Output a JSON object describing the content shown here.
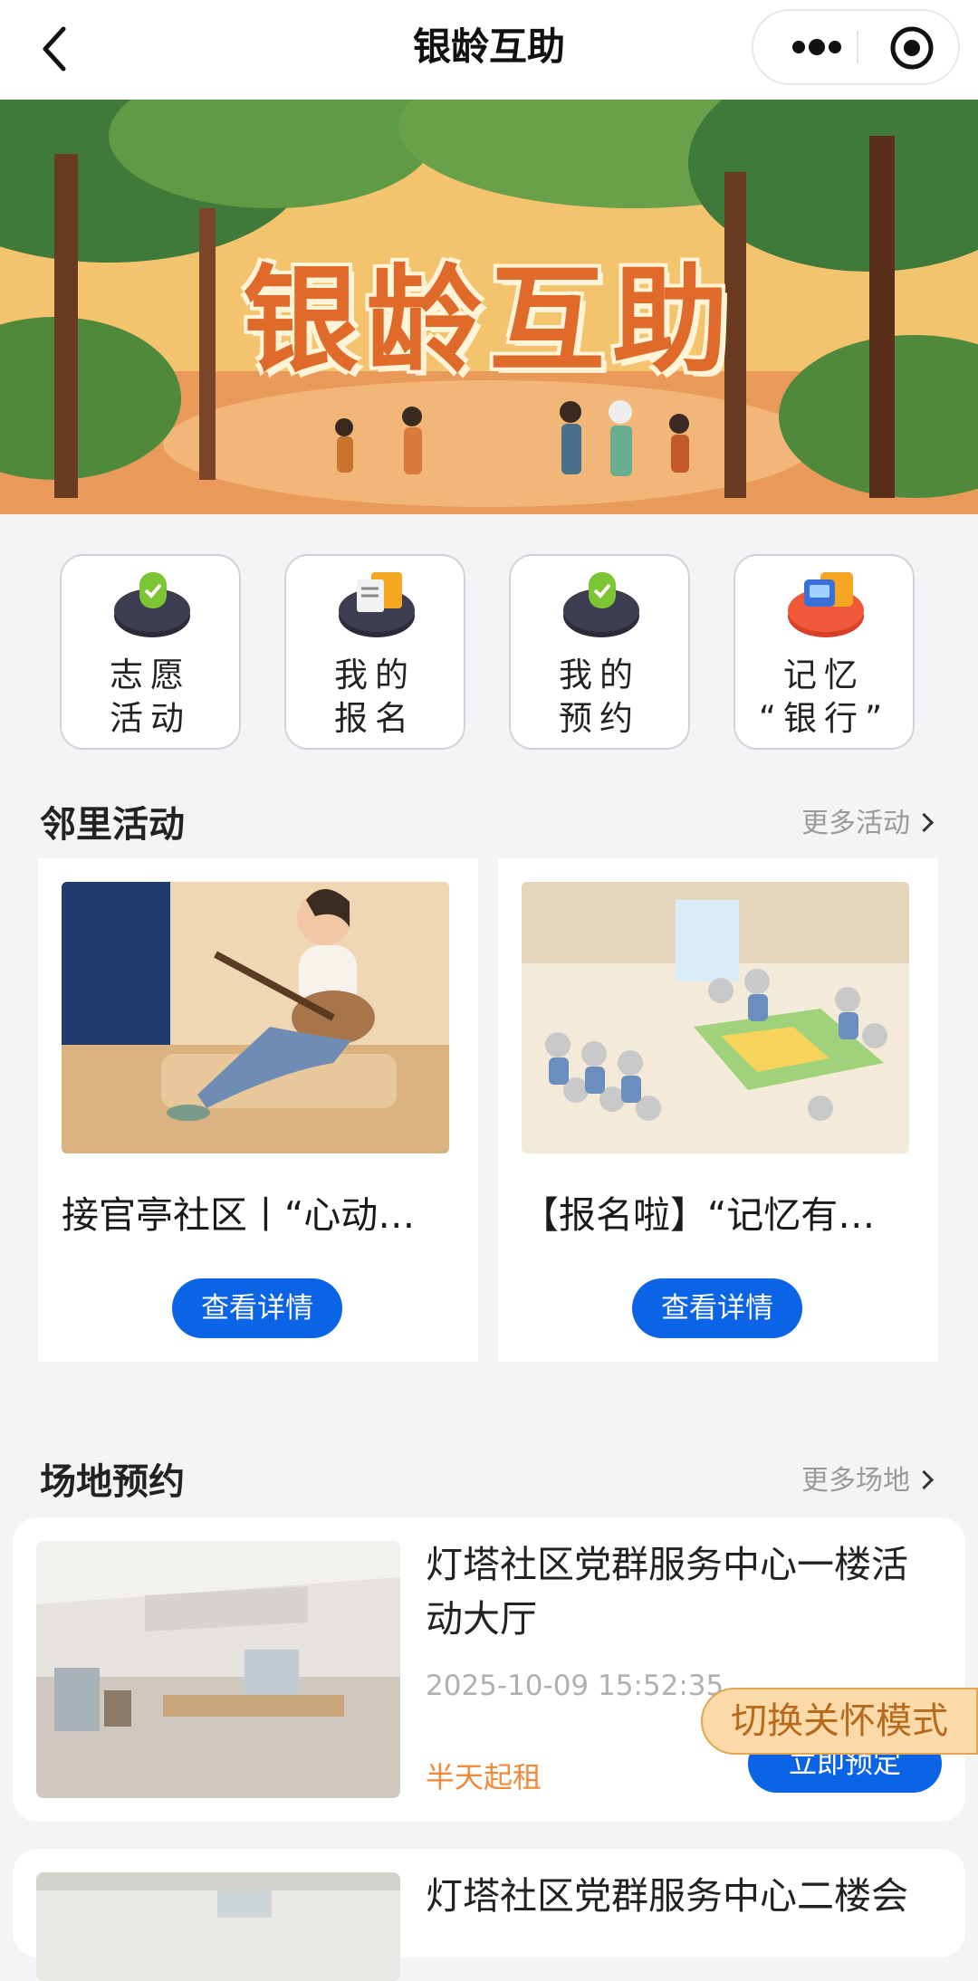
{
  "navbar": {
    "title": "银龄互助"
  },
  "banner": {
    "title": "银龄互助"
  },
  "quick_entries": [
    {
      "label": "志愿\n活动",
      "icon": "volunteer-icon"
    },
    {
      "label": "我的\n报名",
      "icon": "registration-icon"
    },
    {
      "label": "我的\n预约",
      "icon": "reservation-icon"
    },
    {
      "label": "记忆\n“银行”",
      "icon": "memory-bank-icon"
    }
  ],
  "activities": {
    "title": "邻里活动",
    "more": "更多活动",
    "cards": [
      {
        "title": "接官亭社区丨“心动…",
        "button": "查看详情"
      },
      {
        "title": "【报名啦】“记忆有…",
        "button": "查看详情"
      }
    ]
  },
  "venues": {
    "title": "场地预约",
    "more": "更多场地",
    "items": [
      {
        "name": "灯塔社区党群服务中心一楼活动大厅",
        "time": "2025-10-09 15:52:35",
        "price": "半天起租",
        "button": "立即预定"
      },
      {
        "name": "灯塔社区党群服务中心二楼会"
      }
    ]
  },
  "care_mode": {
    "label": "切换关怀模式"
  },
  "colors": {
    "primary": "#0b63e5",
    "accent_orange": "#f28a3a",
    "care_bg": "#fbd9a8"
  }
}
